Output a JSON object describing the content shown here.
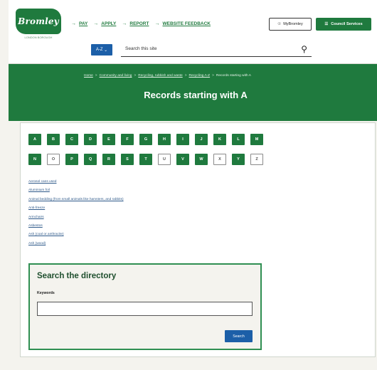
{
  "header": {
    "logo_text": "Bromley",
    "logo_sub": "LONDON BOROUGH",
    "nav": [
      {
        "label": "PAY"
      },
      {
        "label": "APPLY"
      },
      {
        "label": "REPORT"
      },
      {
        "label": "WEBSITE FEEDBACK"
      }
    ],
    "mybromley_label": "MyBromley",
    "council_services_label": "Council Services",
    "az_label": "A-Z",
    "search_placeholder": "Search this site"
  },
  "breadcrumb": {
    "items": [
      "Home",
      "Community and living",
      "Recycling, rubbish and waste",
      "Recycling A-Z"
    ],
    "current": "Records starting with A"
  },
  "page_title": "Records starting with A",
  "letters_row1": [
    "A",
    "B",
    "C",
    "D",
    "E",
    "F",
    "G",
    "H",
    "I",
    "J",
    "K",
    "L",
    "M"
  ],
  "letters_row2": [
    {
      "l": "N",
      "empty": false
    },
    {
      "l": "O",
      "empty": true
    },
    {
      "l": "P",
      "empty": false
    },
    {
      "l": "Q",
      "empty": false
    },
    {
      "l": "R",
      "empty": false
    },
    {
      "l": "S",
      "empty": false
    },
    {
      "l": "T",
      "empty": false
    },
    {
      "l": "U",
      "empty": true
    },
    {
      "l": "V",
      "empty": false
    },
    {
      "l": "W",
      "empty": false
    },
    {
      "l": "X",
      "empty": true
    },
    {
      "l": "Y",
      "empty": false
    },
    {
      "l": "Z",
      "empty": true
    }
  ],
  "records": [
    "Aerosol cans used",
    "Aluminium foil",
    "Animal bedding (from small animals like hamsters, and rabbits)",
    "Anti-freeze",
    "Armchairs",
    "Asbestos",
    "Ash (coal or anthracite)",
    "Ash (wood)"
  ],
  "directory": {
    "title": "Search the directory",
    "keywords_label": "Keywords",
    "keywords_value": "",
    "search_button": "Search"
  }
}
